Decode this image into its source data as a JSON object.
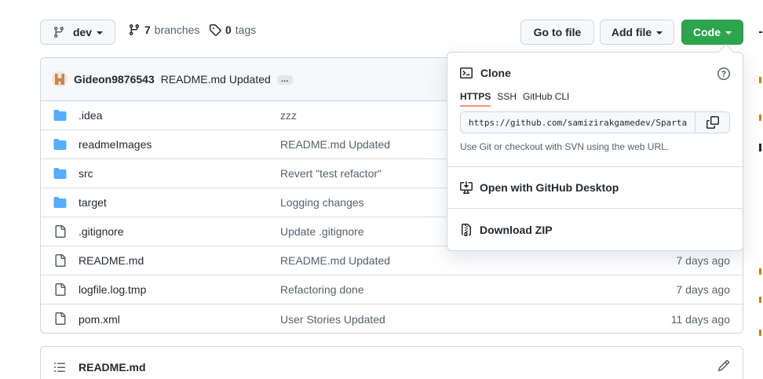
{
  "branch": {
    "name": "dev",
    "icon": "git-branch-icon"
  },
  "stats": {
    "branches_count": "7",
    "branches_label": "branches",
    "tags_count": "0",
    "tags_label": "tags"
  },
  "actions": {
    "go_to_file": "Go to file",
    "add_file": "Add file",
    "code": "Code"
  },
  "commit": {
    "author": "Gideon9876543",
    "message": "README.md Updated",
    "more": "…"
  },
  "files": [
    {
      "type": "folder",
      "name": ".idea",
      "message": "zzz",
      "date": ""
    },
    {
      "type": "folder",
      "name": "readmeImages",
      "message": "README.md Updated",
      "date": ""
    },
    {
      "type": "folder",
      "name": "src",
      "message": "Revert \"test refactor\"",
      "date": ""
    },
    {
      "type": "folder",
      "name": "target",
      "message": "Logging changes",
      "date": ""
    },
    {
      "type": "file",
      "name": ".gitignore",
      "message": "Update .gitignore",
      "date": ""
    },
    {
      "type": "file",
      "name": "README.md",
      "message": "README.md Updated",
      "date": "7 days ago"
    },
    {
      "type": "file",
      "name": "logfile.log.tmp",
      "message": "Refactoring done",
      "date": "7 days ago"
    },
    {
      "type": "file",
      "name": "pom.xml",
      "message": "User Stories Updated",
      "date": "11 days ago"
    }
  ],
  "readme": {
    "title": "README.md"
  },
  "clone": {
    "title": "Clone",
    "tabs": [
      "HTTPS",
      "SSH",
      "GitHub CLI"
    ],
    "active_tab": "HTTPS",
    "url": "https://github.com/samizirakgamedev/SpartaGlobal",
    "hint": "Use Git or checkout with SVN using the web URL.",
    "open_desktop": "Open with GitHub Desktop",
    "download_zip": "Download ZIP"
  },
  "colors": {
    "code_button": "#2da44e",
    "folder_icon": "#54aeff",
    "active_tab_underline": "#fd8c73"
  }
}
